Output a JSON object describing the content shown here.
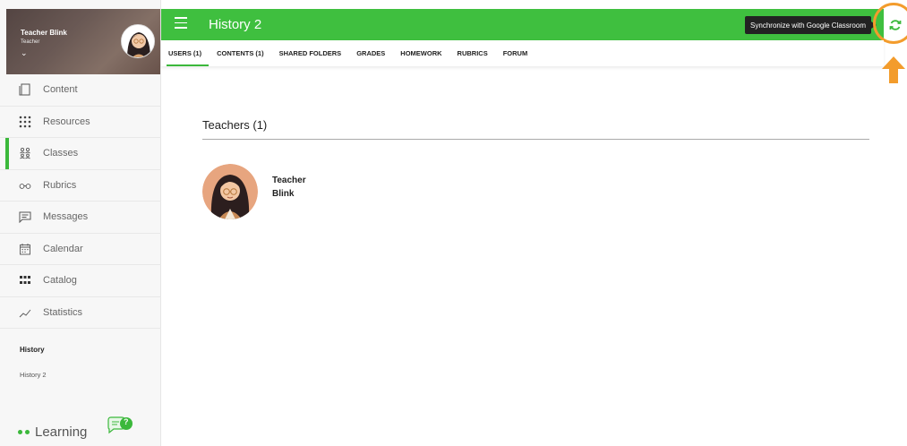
{
  "profile": {
    "name": "Teacher Blink",
    "role": "Teacher",
    "chevron": "⌄"
  },
  "sidebar": {
    "items": [
      {
        "label": "Content",
        "icon": "document-icon"
      },
      {
        "label": "Resources",
        "icon": "grid-dots-icon"
      },
      {
        "label": "Classes",
        "icon": "people-icon",
        "active": true
      },
      {
        "label": "Rubrics",
        "icon": "glasses-icon"
      },
      {
        "label": "Messages",
        "icon": "message-icon"
      },
      {
        "label": "Calendar",
        "icon": "calendar-icon"
      },
      {
        "label": "Catalog",
        "icon": "catalog-icon"
      },
      {
        "label": "Statistics",
        "icon": "chart-line-icon"
      }
    ],
    "section_title": "History",
    "section_item": "History 2",
    "brand": "Learning",
    "help_badge": "?"
  },
  "topbar": {
    "title": "History 2",
    "sync_tooltip": "Synchronize with Google Classroom"
  },
  "tabs": [
    {
      "label": "USERS (1)",
      "active": true
    },
    {
      "label": "CONTENTS (1)"
    },
    {
      "label": "SHARED FOLDERS"
    },
    {
      "label": "GRADES"
    },
    {
      "label": "HOMEWORK"
    },
    {
      "label": "RUBRICS"
    },
    {
      "label": "FORUM"
    }
  ],
  "main": {
    "section_header": "Teachers (1)",
    "user": {
      "first": "Teacher",
      "last": "Blink"
    }
  },
  "colors": {
    "accent": "#3fbf3f",
    "highlight": "#f39c2c"
  }
}
